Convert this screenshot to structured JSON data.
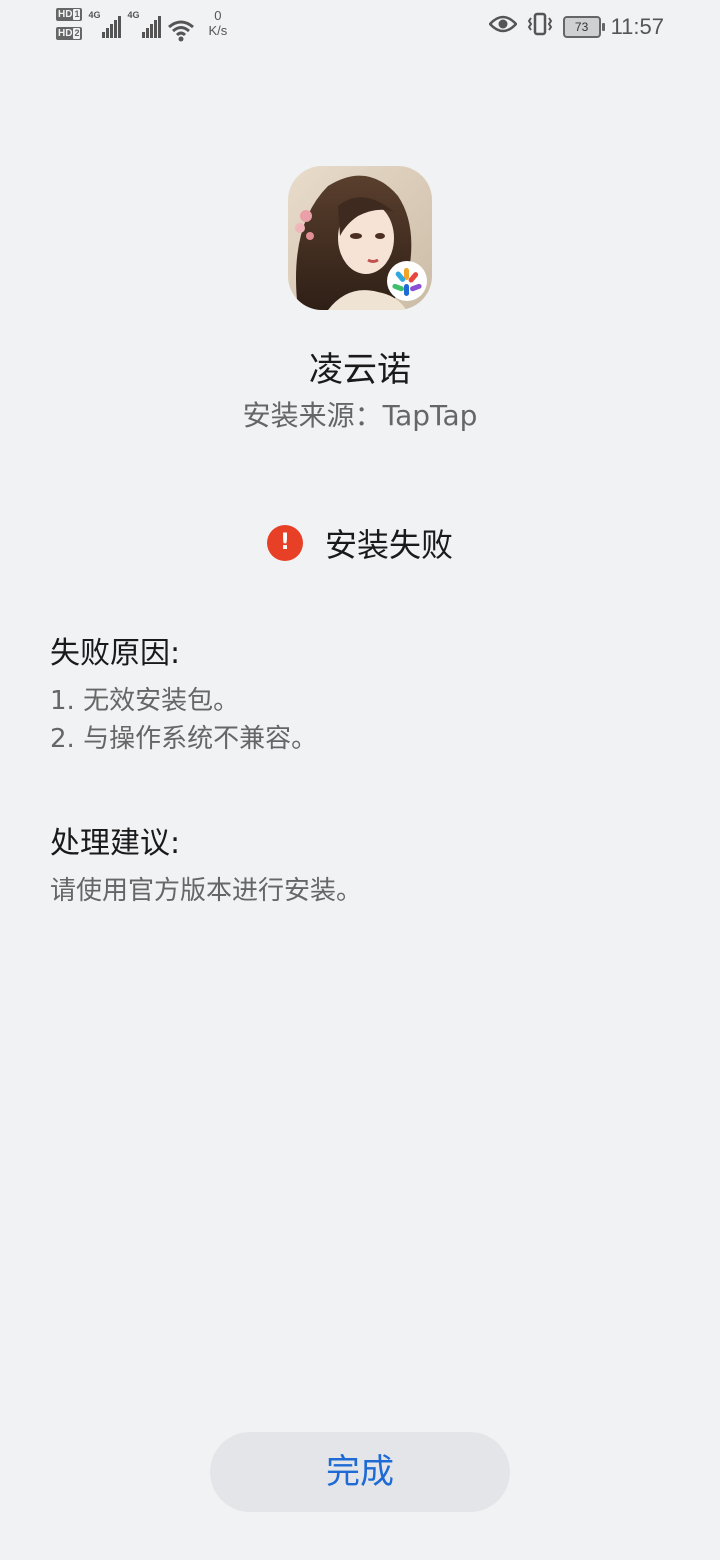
{
  "status_bar": {
    "sim1": "HD",
    "sim1_num": "1",
    "sim2": "HD",
    "sim2_num": "2",
    "network1": "4G",
    "network2": "4G",
    "speed_value": "0",
    "speed_unit": "K/s",
    "battery": "73",
    "time": "11:57",
    "icons": [
      "wifi-icon",
      "eye-icon",
      "vibrate-icon",
      "battery-icon"
    ]
  },
  "app": {
    "name": "凌云诺",
    "source": "安装来源：TapTap",
    "icon": "app-icon",
    "badge": "installer-badge-icon"
  },
  "status": {
    "icon": "error-icon",
    "text": "安装失败",
    "color": "#e84026"
  },
  "reasons": {
    "title": "失败原因:",
    "items": [
      "1. 无效安装包。",
      "2. 与操作系统不兼容。"
    ]
  },
  "suggestion": {
    "title": "处理建议:",
    "text": "请使用官方版本进行安装。"
  },
  "done_button": {
    "label": "完成",
    "color": "#1e6bd6"
  }
}
